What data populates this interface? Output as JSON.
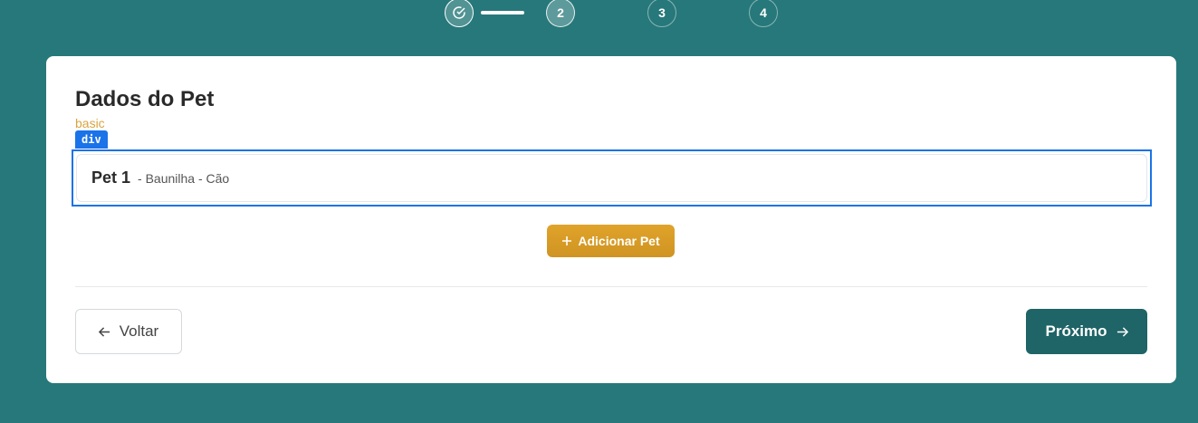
{
  "stepper": {
    "steps": [
      {
        "label": "",
        "state": "done",
        "icon": "check-circle-icon"
      },
      {
        "label": "2",
        "state": "active"
      },
      {
        "label": "3",
        "state": "pending"
      },
      {
        "label": "4",
        "state": "pending"
      }
    ]
  },
  "card": {
    "title": "Dados do Pet",
    "subtitle": "basic",
    "debug_tag": "div",
    "pets": [
      {
        "name": "Pet 1",
        "details": "- Baunilha - Cão"
      }
    ],
    "add_pet_label": "Adicionar Pet",
    "back_label": "Voltar",
    "next_label": "Próximo"
  },
  "colors": {
    "background": "#27787a",
    "accent_gold": "#d99c26",
    "primary": "#1f6466",
    "highlight": "#1a73e8"
  }
}
